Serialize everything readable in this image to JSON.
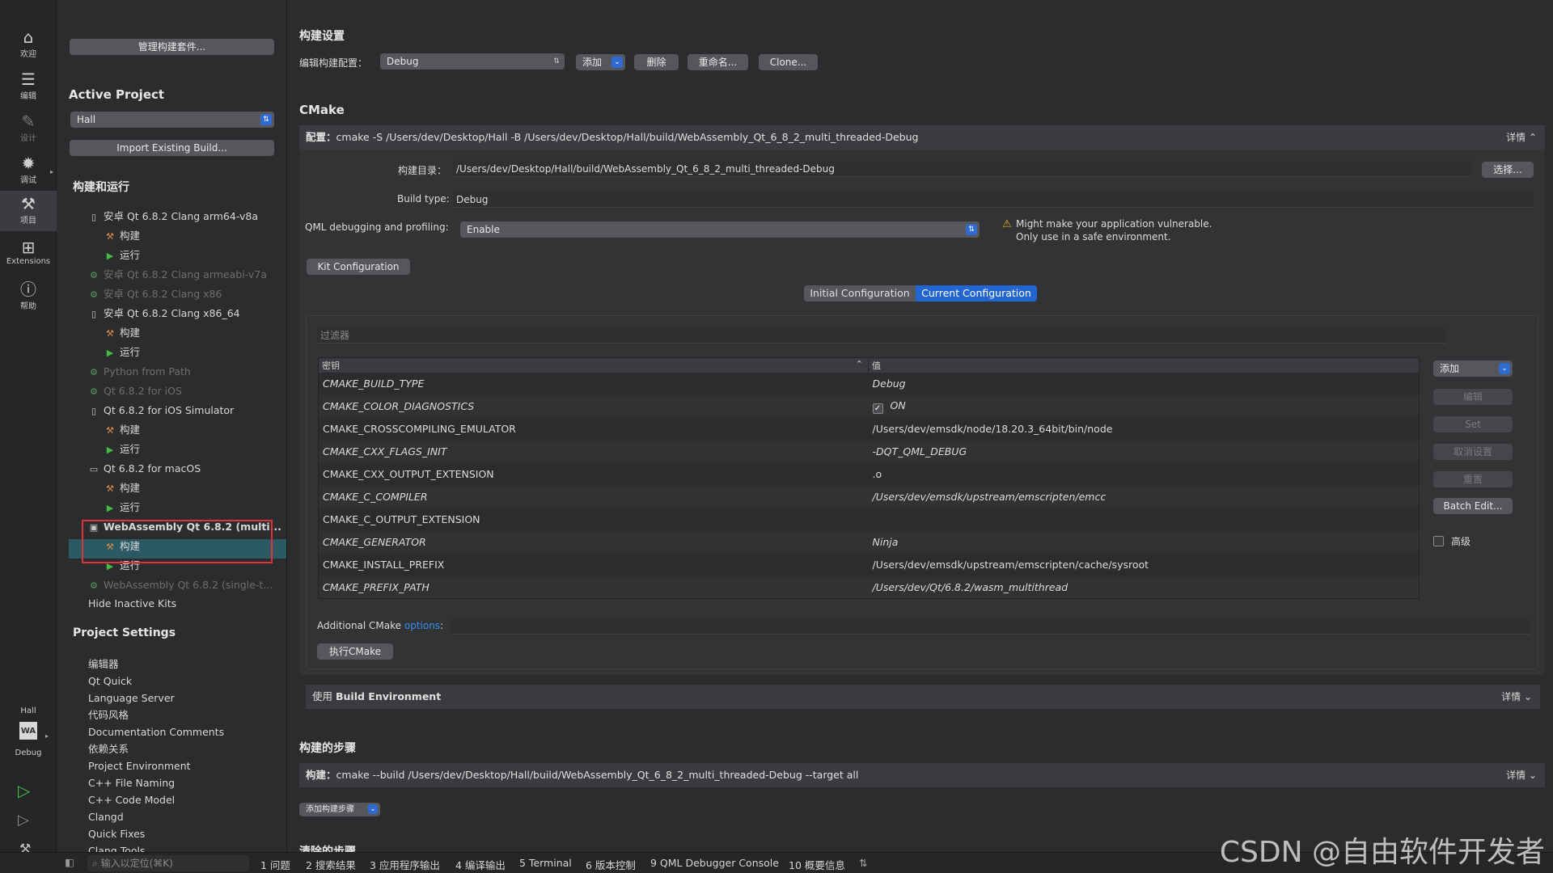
{
  "modebar": {
    "items": [
      {
        "label": "欢迎",
        "icon": "home-icon"
      },
      {
        "label": "编辑",
        "icon": "edit-icon"
      },
      {
        "label": "设计",
        "icon": "design-icon"
      },
      {
        "label": "调试",
        "icon": "debug-icon"
      },
      {
        "label": "项目",
        "icon": "wrench-icon"
      },
      {
        "label": "Extensions",
        "icon": "extensions-icon"
      },
      {
        "label": "帮助",
        "icon": "help-icon"
      }
    ],
    "project_name": "Hall",
    "target_badge": "WA",
    "target_config": "Debug"
  },
  "sidebar": {
    "manage_kits": "管理构建套件...",
    "active_project_heading": "Active Project",
    "active_project": "Hall",
    "import_build": "Import Existing Build...",
    "build_run_heading": "构建和运行",
    "tree": [
      {
        "label": "安卓 Qt 6.8.2 Clang arm64-v8a",
        "level": 0,
        "kind": "device",
        "dim": false
      },
      {
        "label": "构建",
        "level": 1,
        "kind": "build",
        "dim": false
      },
      {
        "label": "运行",
        "level": 1,
        "kind": "run",
        "dim": false
      },
      {
        "label": "安卓 Qt 6.8.2 Clang armeabi-v7a",
        "level": 0,
        "kind": "inactive",
        "dim": true
      },
      {
        "label": "安卓 Qt 6.8.2 Clang x86",
        "level": 0,
        "kind": "inactive",
        "dim": true
      },
      {
        "label": "安卓 Qt 6.8.2 Clang x86_64",
        "level": 0,
        "kind": "device",
        "dim": false
      },
      {
        "label": "构建",
        "level": 1,
        "kind": "build",
        "dim": false
      },
      {
        "label": "运行",
        "level": 1,
        "kind": "run",
        "dim": false
      },
      {
        "label": "Python from Path",
        "level": 0,
        "kind": "inactive",
        "dim": true
      },
      {
        "label": "Qt 6.8.2 for iOS",
        "level": 0,
        "kind": "inactive",
        "dim": true
      },
      {
        "label": "Qt 6.8.2 for iOS Simulator",
        "level": 0,
        "kind": "device",
        "dim": false
      },
      {
        "label": "构建",
        "level": 1,
        "kind": "build",
        "dim": false
      },
      {
        "label": "运行",
        "level": 1,
        "kind": "run",
        "dim": false
      },
      {
        "label": "Qt 6.8.2 for macOS",
        "level": 0,
        "kind": "desktop",
        "dim": false
      },
      {
        "label": "构建",
        "level": 1,
        "kind": "build",
        "dim": false
      },
      {
        "label": "运行",
        "level": 1,
        "kind": "run",
        "dim": false
      },
      {
        "label": "WebAssembly Qt 6.8.2 (multi...",
        "level": 0,
        "kind": "wasm",
        "dim": false,
        "bold": true
      },
      {
        "label": "构建",
        "level": 1,
        "kind": "build",
        "dim": false,
        "selected": true
      },
      {
        "label": "运行",
        "level": 1,
        "kind": "run",
        "dim": false
      },
      {
        "label": "WebAssembly Qt 6.8.2 (single-t...",
        "level": 0,
        "kind": "inactive",
        "dim": true
      }
    ],
    "hide_inactive": "Hide Inactive Kits",
    "project_settings_heading": "Project Settings",
    "project_settings": [
      "编辑器",
      "Qt Quick",
      "Language Server",
      "代码风格",
      "Documentation Comments",
      "依赖关系",
      "Project Environment",
      "C++ File Naming",
      "C++ Code Model",
      "Clangd",
      "Quick Fixes",
      "Clang Tools"
    ]
  },
  "main": {
    "build_settings_heading": "构建设置",
    "edit_config_label": "编辑构建配置：",
    "config_value": "Debug",
    "add_label": "添加",
    "delete_label": "删除",
    "rename_label": "重命名...",
    "clone_label": "Clone...",
    "cmake_heading": "CMake",
    "config_prefix": "配置：",
    "config_command": "cmake -S /Users/dev/Desktop/Hall -B /Users/dev/Desktop/Hall/build/WebAssembly_Qt_6_8_2_multi_threaded-Debug",
    "details_label": "详情",
    "build_dir_label": "构建目录：",
    "build_dir_value": "/Users/dev/Desktop/Hall/build/WebAssembly_Qt_6_8_2_multi_threaded-Debug",
    "choose_label": "选择...",
    "build_type_label": "Build type:",
    "build_type_value": "Debug",
    "qml_label": "QML debugging and profiling:",
    "qml_value": "Enable",
    "warning_line1": "Might make your application vulnerable.",
    "warning_line2": "Only use in a safe environment.",
    "kit_config_label": "Kit Configuration",
    "tab_initial": "Initial Configuration",
    "tab_current": "Current Configuration",
    "filter_placeholder": "过滤器",
    "col_key": "密钥",
    "col_value": "值",
    "rows": [
      {
        "key": "CMAKE_BUILD_TYPE",
        "value": "Debug",
        "italic": true
      },
      {
        "key": "CMAKE_COLOR_DIAGNOSTICS",
        "value": "ON",
        "italic": true,
        "checkbox": true
      },
      {
        "key": "CMAKE_CROSSCOMPILING_EMULATOR",
        "value": "/Users/dev/emsdk/node/18.20.3_64bit/bin/node",
        "italic": false
      },
      {
        "key": "CMAKE_CXX_FLAGS_INIT",
        "value": "-DQT_QML_DEBUG",
        "italic": true
      },
      {
        "key": "CMAKE_CXX_OUTPUT_EXTENSION",
        "value": ".o",
        "italic": false
      },
      {
        "key": "CMAKE_C_COMPILER",
        "value": "/Users/dev/emsdk/upstream/emscripten/emcc",
        "italic": true
      },
      {
        "key": "CMAKE_C_OUTPUT_EXTENSION",
        "value": "",
        "italic": false
      },
      {
        "key": "CMAKE_GENERATOR",
        "value": "Ninja",
        "italic": true
      },
      {
        "key": "CMAKE_INSTALL_PREFIX",
        "value": "/Users/dev/emsdk/upstream/emscripten/cache/sysroot",
        "italic": false
      },
      {
        "key": "CMAKE_PREFIX_PATH",
        "value": "/Users/dev/Qt/6.8.2/wasm_multithread",
        "italic": true
      }
    ],
    "side_add": "添加",
    "side_edit": "编辑",
    "side_set": "Set",
    "side_unset": "取消设置",
    "side_reset": "重置",
    "side_batch": "Batch Edit...",
    "side_advanced": "高级",
    "additional_prefix": "Additional CMake ",
    "additional_link": "options",
    "additional_suffix": ":",
    "run_cmake": "执行CMake",
    "env_prefix": "使用 ",
    "env_bold": "Build Environment",
    "build_steps_heading": "构建的步骤",
    "build_step_prefix": "构建：",
    "build_step_command": "cmake --build /Users/dev/Desktop/Hall/build/WebAssembly_Qt_6_8_2_multi_threaded-Debug --target all",
    "add_build_step": "添加构建步骤",
    "clean_steps_heading": "清除的步骤"
  },
  "statusbar": {
    "locate_placeholder": "输入以定位(⌘K)",
    "panes": [
      "1  问题",
      "2  搜索结果",
      "3  应用程序输出",
      "4  编译输出",
      "5  Terminal",
      "6  版本控制",
      "9  QML Debugger Console",
      "10  概要信息"
    ]
  },
  "watermark": "CSDN @自由软件开发者"
}
